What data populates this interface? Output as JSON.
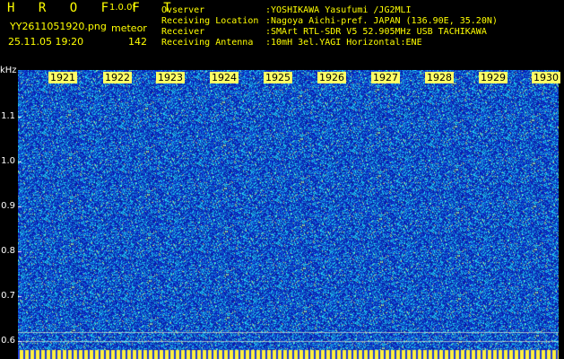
{
  "header": {
    "title": "H R O F F T",
    "version": "1.0.0f",
    "filename": "YY2611051920.png",
    "meteor_label": "meteor",
    "datetime": "25.11.05 19:20",
    "meteor_count": "142"
  },
  "info": [
    {
      "key": "Ovserver",
      "value": ":YOSHIKAWA Yasufumi /JG2MLI"
    },
    {
      "key": "Receiving Location",
      "value": ":Nagoya Aichi-pref. JAPAN (136.90E, 35.20N)"
    },
    {
      "key": "Receiver",
      "value": ":SMArt RTL-SDR V5 52.905MHz USB TACHIKAWA"
    },
    {
      "key": "Receiving Antenna",
      "value": ":10mH 3el.YAGI Horizontal:ENE"
    }
  ],
  "axis": {
    "unit": "kHz",
    "yticks": [
      "1.1",
      "1.0",
      "0.9",
      "0.8",
      "0.7",
      "0.6"
    ],
    "minutes": [
      "1921",
      "1922",
      "1923",
      "1924",
      "1925",
      "1926",
      "1927",
      "1928",
      "1929",
      "1930"
    ]
  },
  "colors": {
    "background": "#000000",
    "text": "#ffff00",
    "spectrogram_base": "#0a1fa8",
    "spectrogram_noise": "#33ccff",
    "marker": "#ffff66"
  }
}
